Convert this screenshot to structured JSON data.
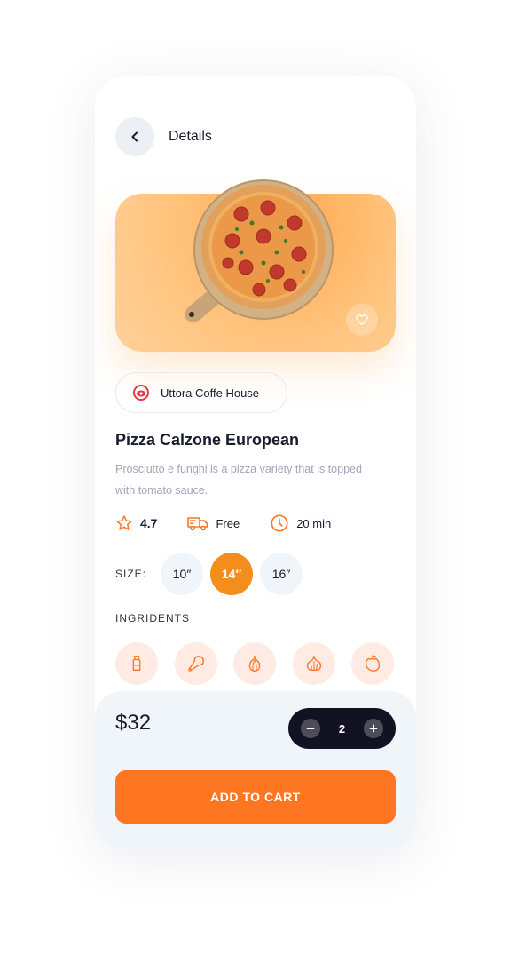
{
  "header": {
    "title": "Details"
  },
  "restaurant": {
    "name": "Uttora Coffe House"
  },
  "product": {
    "title": "Pizza Calzone European",
    "description": "Prosciutto e funghi is a pizza variety that is topped with tomato sauce."
  },
  "stats": {
    "rating": "4.7",
    "delivery": "Free",
    "time": "20 min"
  },
  "size": {
    "label": "SIZE:",
    "options": [
      "10″",
      "14″",
      "16″"
    ],
    "selected": "14″"
  },
  "ingredients": {
    "title": "INGRIDENTS",
    "items": [
      "salt-icon",
      "chicken-icon",
      "onion-icon",
      "garlic-icon",
      "pepper-icon"
    ]
  },
  "cart": {
    "price": "$32",
    "quantity": "2",
    "button_label": "ADD TO CART"
  },
  "colors": {
    "accent": "#FF7622",
    "size_active": "#F58D1D",
    "hero_bg": "#FFC27A",
    "ingredient_bg": "#FFEBE4",
    "dark": "#121223"
  }
}
